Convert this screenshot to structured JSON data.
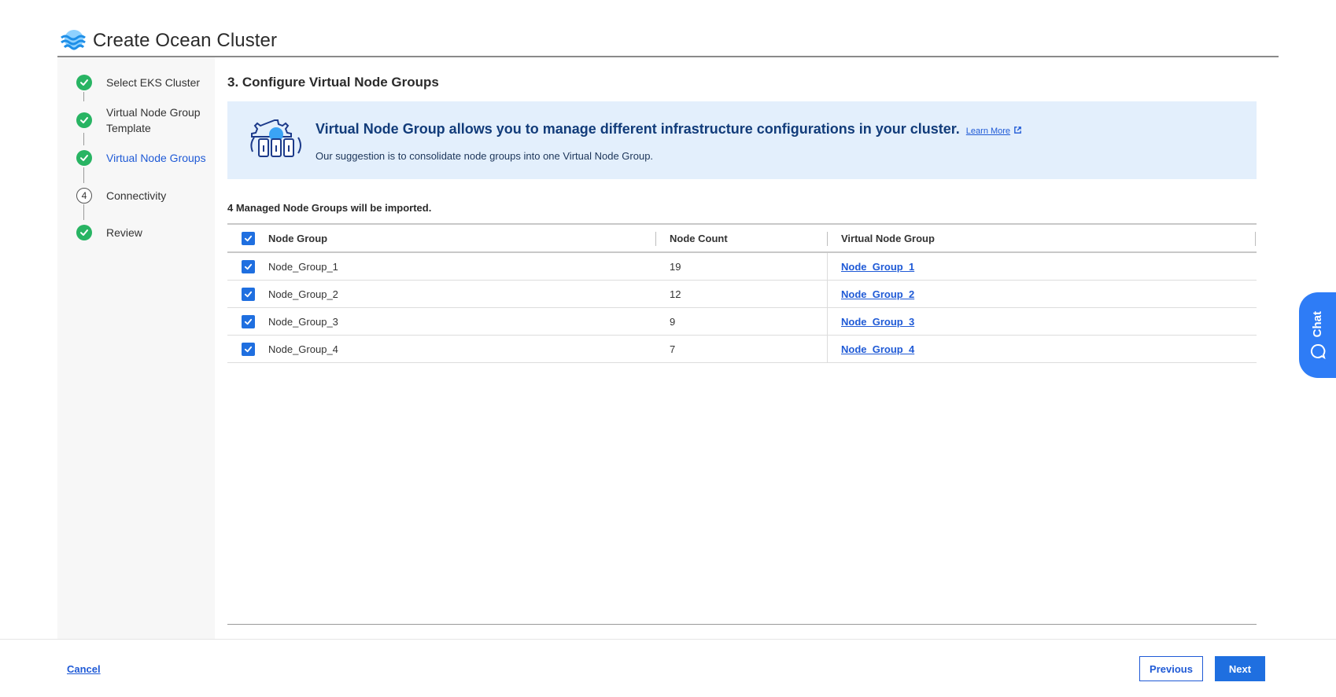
{
  "header": {
    "title": "Create Ocean Cluster",
    "logo_icon": "ocean-waves-icon"
  },
  "steps": [
    {
      "label": "Select EKS Cluster",
      "state": "done"
    },
    {
      "label": "Virtual Node Group Template",
      "state": "done"
    },
    {
      "label": "Virtual Node Groups",
      "state": "done-active"
    },
    {
      "number": "4",
      "label": "Connectivity",
      "state": "pending"
    },
    {
      "label": "Review",
      "state": "done"
    }
  ],
  "main": {
    "section_title": "3. Configure Virtual Node Groups",
    "banner": {
      "heading": "Virtual Node Group allows you to manage different infrastructure configurations in your cluster.",
      "learn_more": "Learn More",
      "subtext": "Our suggestion is to consolidate node groups into one Virtual Node Group."
    },
    "import_note": "4 Managed Node Groups will be imported.",
    "table": {
      "columns": [
        "Node Group",
        "Node Count",
        "Virtual Node Group"
      ],
      "rows": [
        {
          "node_group": "Node_Group_1",
          "node_count": "19",
          "virtual_node_group": "Node_Group_1",
          "checked": true
        },
        {
          "node_group": "Node_Group_2",
          "node_count": "12",
          "virtual_node_group": "Node_Group_2",
          "checked": true
        },
        {
          "node_group": "Node_Group_3",
          "node_count": "9",
          "virtual_node_group": "Node_Group_3",
          "checked": true
        },
        {
          "node_group": "Node_Group_4",
          "node_count": "7",
          "virtual_node_group": "Node_Group_4",
          "checked": true
        }
      ]
    }
  },
  "footer": {
    "cancel_label": "Cancel",
    "previous_label": "Previous",
    "next_label": "Next"
  },
  "chat": {
    "label": "Chat"
  },
  "colors": {
    "accent": "#1f6fe0",
    "success": "#28b463",
    "banner_bg": "#e3effc"
  }
}
